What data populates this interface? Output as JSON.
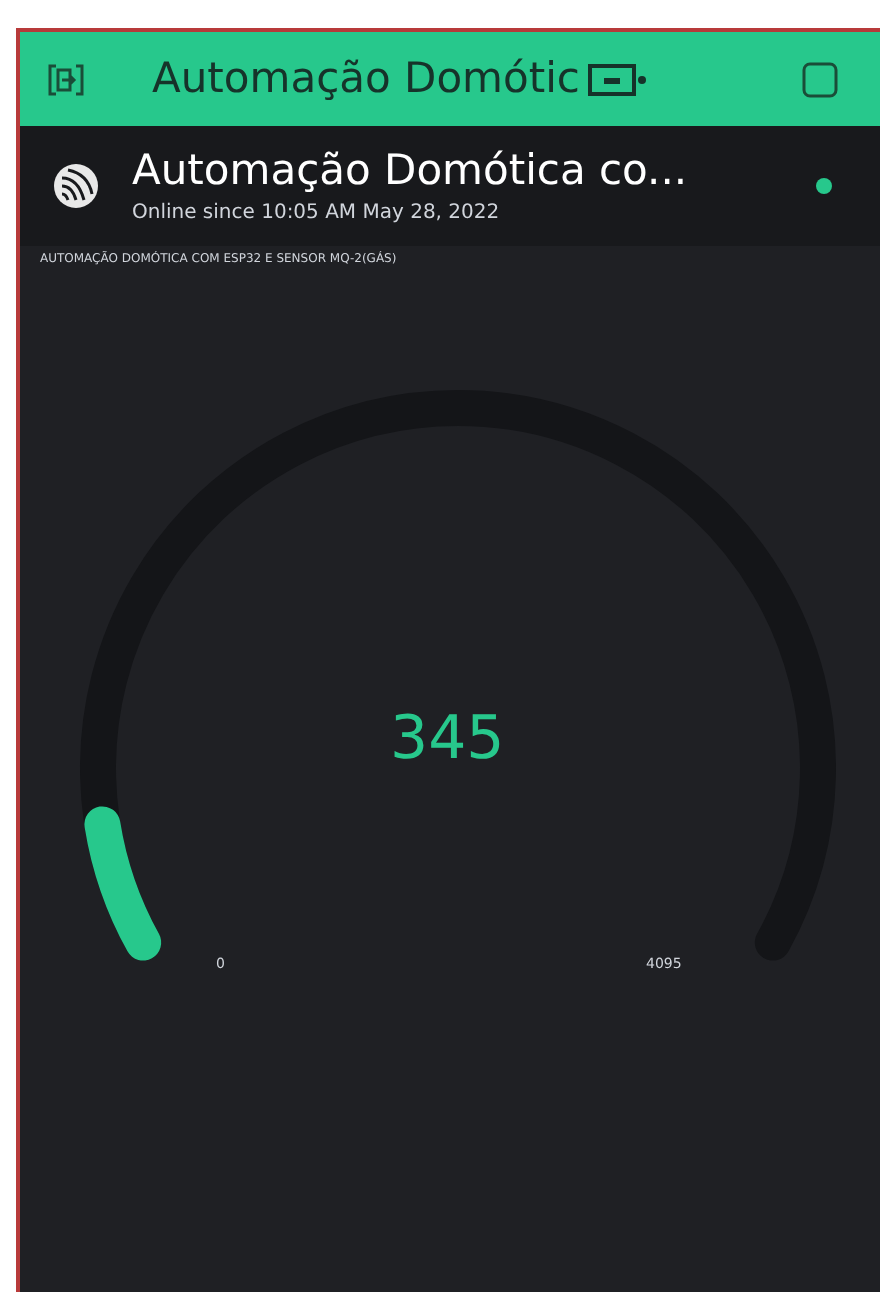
{
  "header": {
    "title": "Automação Domótic"
  },
  "device": {
    "name": "Automação Domótica co...",
    "status": "Online since 10:05 AM May 28, 2022",
    "online": true
  },
  "gauge": {
    "label": "AUTOMAÇÃO DOMÓTICA COM ESP32 E SENSOR MQ-2(GÁS)",
    "value": "345",
    "min": "0",
    "max": "4095"
  }
}
